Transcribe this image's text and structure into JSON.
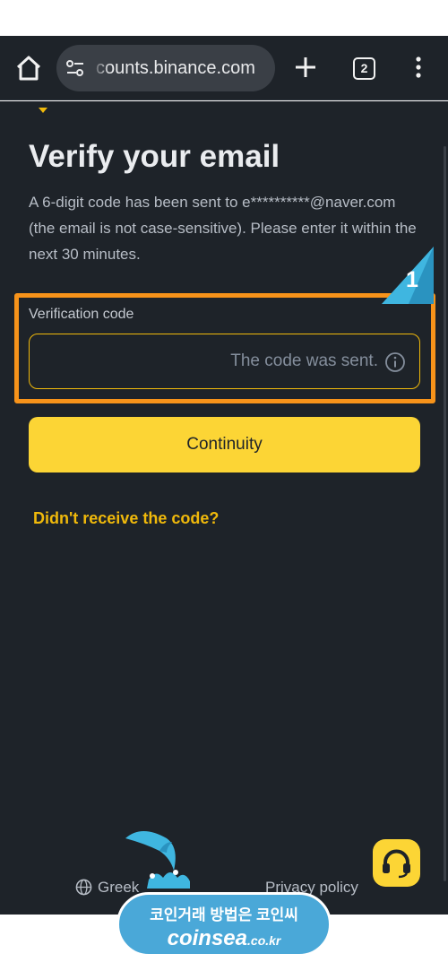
{
  "browser": {
    "url": "counts.binance.com",
    "tab_count": "2",
    "icons": [
      "home-icon",
      "site-settings-icon",
      "plus-icon",
      "tabs-icon",
      "more-vert-icon"
    ]
  },
  "verify": {
    "title": "Verify your email",
    "description": "A 6-digit code has been sent to e**********@naver.com (the email is not case-sensitive). Please enter it within the next 30 minutes.",
    "code_label": "Verification code",
    "code_value": "",
    "code_placeholder": "The code was sent.",
    "continue_label": "Continuity",
    "resend_link": "Didn't receive the code?"
  },
  "footer": {
    "language": "Greek",
    "privacy": "Privacy policy",
    "support_icon": "headset-icon"
  },
  "annotation": {
    "step_number": "1",
    "highlight_color": "#f7931a",
    "marker_color": "#3fb6e0"
  },
  "watermark": {
    "line1": "코인거래 방법은 코인씨",
    "line2": "coinsea",
    "line2_suffix": ".co.kr"
  },
  "colors": {
    "background": "#1e2329",
    "accent": "#fcd535",
    "link": "#f0b90b"
  }
}
